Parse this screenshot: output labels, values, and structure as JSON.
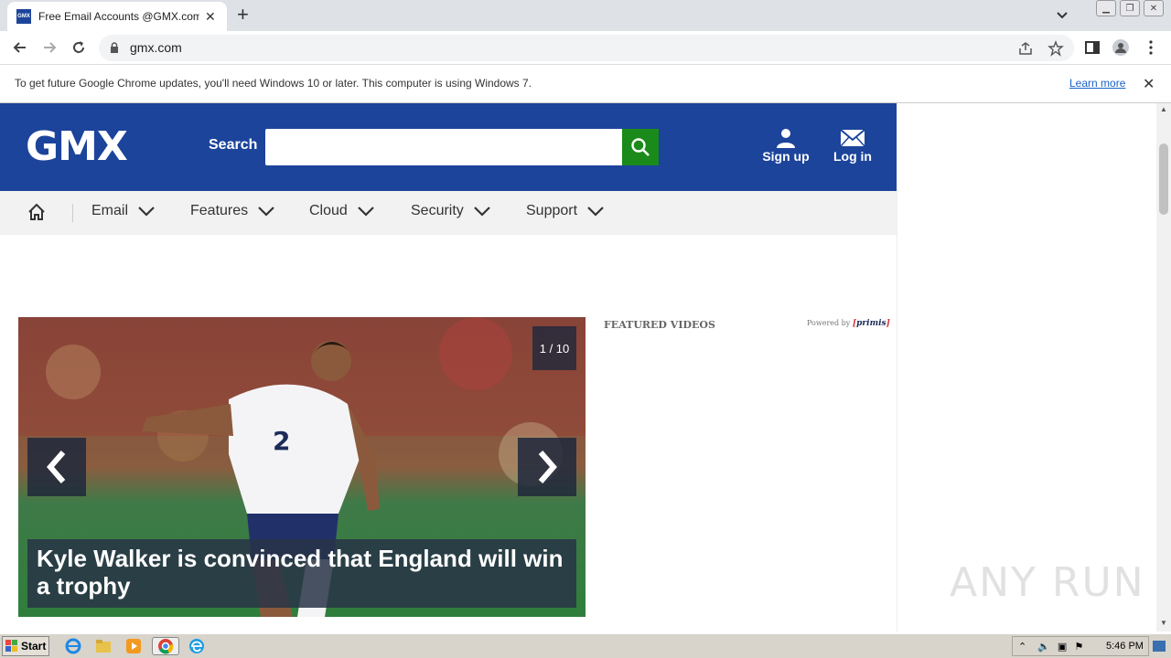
{
  "browser": {
    "tab_title": "Free Email Accounts @GMX.com: Se",
    "tab_favicon_text": "GMX",
    "url": "gmx.com"
  },
  "infobar": {
    "message": "To get future Google Chrome updates, you'll need Windows 10 or later. This computer is using Windows 7.",
    "link": "Learn more"
  },
  "header": {
    "logo": "GMX",
    "search_label": "Search",
    "search_value": "",
    "signup": "Sign up",
    "login": "Log in"
  },
  "nav": {
    "items": [
      {
        "label": "Email"
      },
      {
        "label": "Features"
      },
      {
        "label": "Cloud"
      },
      {
        "label": "Security"
      },
      {
        "label": "Support"
      }
    ]
  },
  "slider": {
    "counter": "1 / 10",
    "caption": "Kyle Walker is convinced that England will win a trophy",
    "jersey_number": "2"
  },
  "sidebar": {
    "featured_title": "FEATURED VIDEOS",
    "powered_by": "Powered by",
    "primis_brand": "primis"
  },
  "watermark": "ANY RUN",
  "taskbar": {
    "start": "Start",
    "clock": "5:46 PM"
  },
  "colors": {
    "brand_blue": "#1c449b",
    "search_green": "#1a8a1a",
    "link_blue": "#1a62c7"
  },
  "icons": [
    "back-icon",
    "forward-icon",
    "reload-icon",
    "lock-icon",
    "share-icon",
    "star-icon",
    "sidepanel-icon",
    "profile-icon",
    "menu-icon",
    "search-icon",
    "user-icon",
    "envelope-icon",
    "home-icon",
    "chevron-down-icon",
    "arrow-left-icon",
    "arrow-right-icon"
  ]
}
